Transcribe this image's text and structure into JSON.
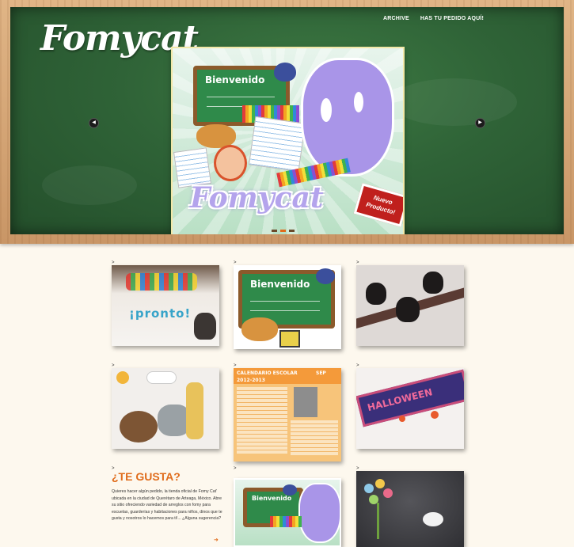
{
  "header": {
    "logo": "Fomycat",
    "nav": [
      {
        "label": "ARCHIVE"
      },
      {
        "label": "HAS TU PEDIDO AQUÍ!"
      }
    ],
    "slider": {
      "prev_icon": "chevron-left-icon",
      "next_icon": "chevron-right-icon",
      "slide_greeting": "Bienvenido",
      "slide_brand": "Fomycat",
      "slide_badge": "Nuevo Producto!",
      "active_dot": 2,
      "dot_count": 3
    }
  },
  "grid": {
    "caret": ">",
    "tiles": [
      {
        "name": "pronto",
        "text": "¡pronto!"
      },
      {
        "name": "bienvenido",
        "text": "Bienvenido"
      },
      {
        "name": "owls",
        "text": ""
      },
      {
        "name": "animals",
        "text": ""
      },
      {
        "name": "calendario",
        "title": "Calendario Escolar",
        "subtitle": "2012-2013",
        "badge": "SEP"
      },
      {
        "name": "halloween",
        "text": "HALLOWEEN"
      },
      {
        "name": "bienvenido-2",
        "text": "Bienvenido"
      },
      {
        "name": "bouquet",
        "text": ""
      }
    ]
  },
  "te_gusta": {
    "title": "¿TE GUSTA?",
    "body": "Quieres hacer algún pedido, la tienda oficial de Fomy Cat' ubicada en la ciudad de Querétaro de Arteaga, México. Abre su sitio ofreciendo variedad de arreglos con fomy para escuelas, guarderías y habitaciones para niños, dinos que te gusta y nosotros lo hacemos para ti!... ¿Alguna sugerencia?",
    "arrow": "➜"
  },
  "colors": {
    "accent": "#e06b1a",
    "board": "#2f6337",
    "wood": "#d6a676"
  }
}
